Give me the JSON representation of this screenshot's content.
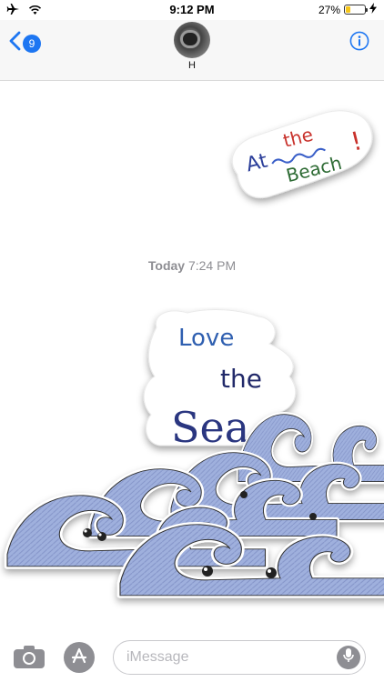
{
  "status_bar": {
    "time": "9:12 PM",
    "battery_percent": "27%",
    "battery_level": 0.27,
    "icons": [
      "airplane-icon",
      "wifi-icon",
      "battery-icon",
      "charging-bolt-icon"
    ]
  },
  "header": {
    "back_badge": "9",
    "contact_name": "H",
    "icons": [
      "back-chevron-icon",
      "info-icon"
    ]
  },
  "thread": {
    "timestamp_day": "Today",
    "timestamp_time": "7:24 PM"
  },
  "stickers": {
    "beach": {
      "word1": "At",
      "word2": "the",
      "word3": "Beach",
      "punct": "!"
    },
    "sea": {
      "line1": "Love",
      "line2": "the",
      "line3": "Sea"
    }
  },
  "input_bar": {
    "placeholder": "iMessage",
    "icons": [
      "camera-icon",
      "app-store-icon",
      "microphone-icon"
    ]
  },
  "colors": {
    "accent": "#1d76f2",
    "wave_fill": "#9fb0dd",
    "battery": "#f5c518",
    "timestamp": "#8e8e93"
  }
}
